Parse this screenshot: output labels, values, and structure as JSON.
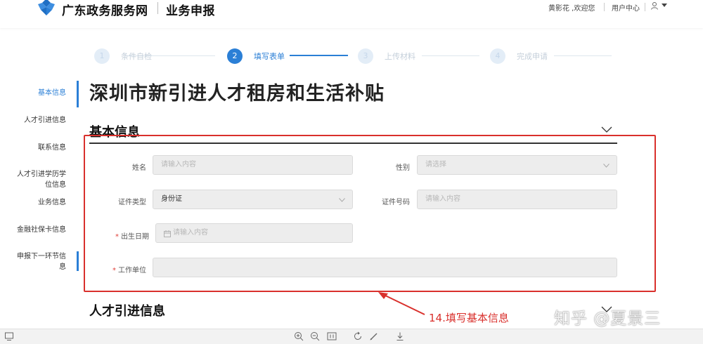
{
  "header": {
    "brand": "广东政务服务网",
    "brand_sub": "业务申报",
    "greeting": "黄影花 ,欢迎您",
    "user_center": "用户中心"
  },
  "steps": [
    {
      "num": "1",
      "label": "条件自检",
      "state": "done"
    },
    {
      "num": "2",
      "label": "填写表单",
      "state": "active"
    },
    {
      "num": "3",
      "label": "上传材料",
      "state": "pending"
    },
    {
      "num": "4",
      "label": "完成申请",
      "state": "pending"
    }
  ],
  "sidebar": {
    "items": [
      {
        "label": "基本信息",
        "active": true
      },
      {
        "label": "人才引进信息",
        "active": false
      },
      {
        "label": "联系信息",
        "active": false
      },
      {
        "label": "人才引进学历学位信息",
        "active": false
      },
      {
        "label": "业务信息",
        "active": false
      },
      {
        "label": "金融社保卡信息",
        "active": false
      },
      {
        "label": "申报下一环节信息",
        "active": false
      }
    ]
  },
  "main": {
    "title": "深圳市新引进人才租房和生活补贴",
    "section_basic": "基本信息",
    "section_talent": "人才引进信息",
    "form": {
      "name_label": "姓名",
      "name_placeholder": "请输入内容",
      "gender_label": "性别",
      "gender_placeholder": "请选择",
      "idtype_label": "证件类型",
      "idtype_value": "身份证",
      "idnum_label": "证件号码",
      "idnum_placeholder": "请输入内容",
      "birth_label": "出生日期",
      "birth_placeholder": "请输入内容",
      "work_label": "工作单位",
      "required_mark": "*"
    }
  },
  "annotation": {
    "text": "14.填写基本信息",
    "color": "#d9302c"
  },
  "watermark": "知乎 @夏景三",
  "colors": {
    "accent": "#2b7fd6",
    "annotation": "#d9302c"
  }
}
